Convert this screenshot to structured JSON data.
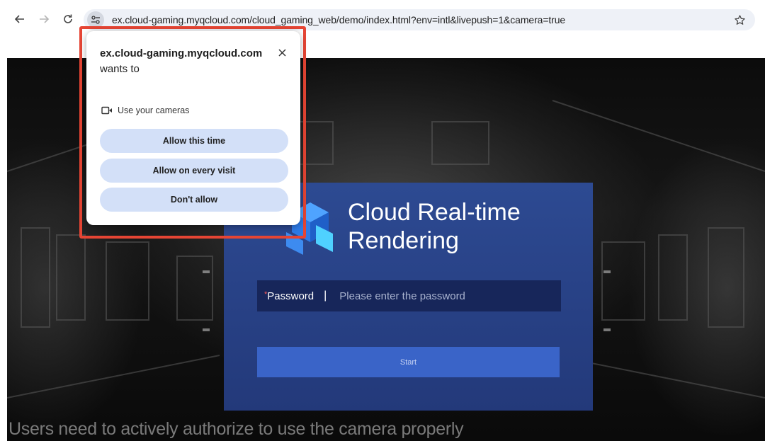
{
  "browser": {
    "url": "ex.cloud-gaming.myqcloud.com/cloud_gaming_web/demo/index.html?env=intl&livepush=1&camera=true",
    "icons": {
      "back": "arrow-left-icon",
      "forward": "arrow-right-icon",
      "reload": "reload-icon",
      "site_info": "tune-icon",
      "bookmark": "star-icon"
    }
  },
  "permission_popup": {
    "site": "ex.cloud-gaming.myqcloud.com",
    "wants_text": " wants to",
    "permission": "Use your cameras",
    "permission_icon": "video-camera-icon",
    "buttons": {
      "allow_once": "Allow this time",
      "allow_always": "Allow on every visit",
      "deny": "Don't allow"
    },
    "close_icon": "close-icon"
  },
  "login": {
    "title": "Cloud Real-time Rendering",
    "required_mark": "*",
    "password_label": "Password",
    "separator": "|",
    "password_placeholder": "Please enter the password",
    "start_label": "Start"
  },
  "caption": "Users need to actively authorize to use the camera properly",
  "colors": {
    "highlight": "#e64534",
    "popup_button": "#d3e0f8",
    "card": "#2d4a92",
    "start_button": "#3a64c8"
  }
}
